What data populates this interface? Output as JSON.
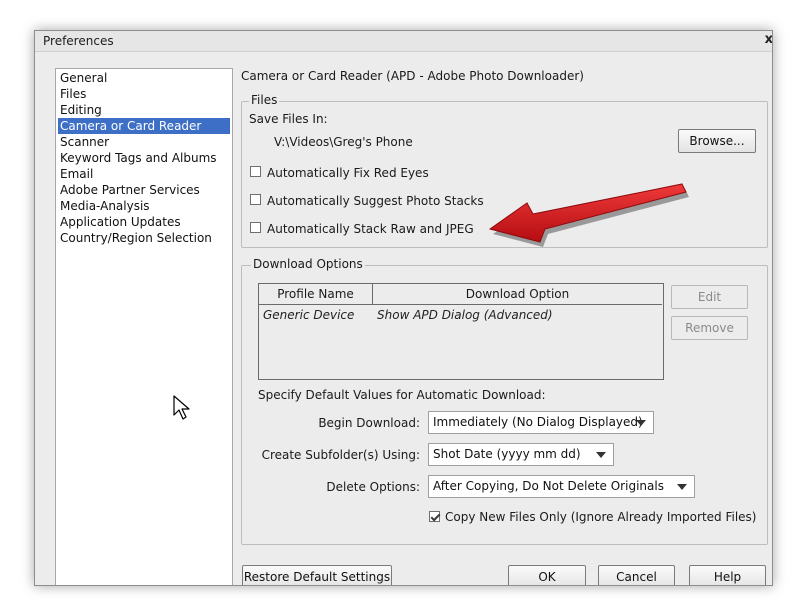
{
  "window": {
    "title": "Preferences",
    "close_glyph": "x"
  },
  "categories": [
    {
      "label": "General",
      "selected": false
    },
    {
      "label": "Files",
      "selected": false
    },
    {
      "label": "Editing",
      "selected": false
    },
    {
      "label": "Camera or Card Reader",
      "selected": true
    },
    {
      "label": "Scanner",
      "selected": false
    },
    {
      "label": "Keyword Tags and Albums",
      "selected": false
    },
    {
      "label": "Email",
      "selected": false
    },
    {
      "label": "Adobe Partner Services",
      "selected": false
    },
    {
      "label": "Media-Analysis",
      "selected": false
    },
    {
      "label": "Application Updates",
      "selected": false
    },
    {
      "label": "Country/Region Selection",
      "selected": false
    }
  ],
  "panel": {
    "heading": "Camera or Card Reader (APD - Adobe Photo Downloader)",
    "files": {
      "legend": "Files",
      "save_label": "Save Files In:",
      "save_path": "V:\\Videos\\Greg's Phone",
      "browse_label": "Browse...",
      "checkboxes": [
        {
          "label": "Automatically Fix Red Eyes",
          "checked": false
        },
        {
          "label": "Automatically Suggest Photo Stacks",
          "checked": false
        },
        {
          "label": "Automatically Stack Raw and JPEG",
          "checked": false
        }
      ]
    },
    "download": {
      "legend": "Download Options",
      "table": {
        "columns": [
          "Profile Name",
          "Download Option"
        ],
        "rows": [
          [
            "Generic Device",
            "Show APD Dialog (Advanced)"
          ]
        ]
      },
      "edit_label": "Edit",
      "remove_label": "Remove",
      "defaults_label": "Specify Default Values for Automatic Download:",
      "begin_label": "Begin Download:",
      "begin_value": "Immediately (No Dialog Displayed)",
      "subfolder_label": "Create Subfolder(s) Using:",
      "subfolder_value": "Shot Date (yyyy mm dd)",
      "delete_label": "Delete Options:",
      "delete_value": "After Copying, Do Not Delete Originals",
      "copy_new_label": "Copy New Files Only (Ignore Already Imported Files)",
      "copy_new_checked": true
    }
  },
  "footer": {
    "restore_label": "Restore Default Settings",
    "ok_label": "OK",
    "cancel_label": "Cancel",
    "help_label": "Help"
  },
  "colors": {
    "selection": "#3d6fc6",
    "annotation_arrow": "#d9161b",
    "dialog_bg": "#ececec"
  },
  "icons": {
    "annotation": "red-arrow-icon",
    "cursor": "mouse-pointer-icon"
  }
}
